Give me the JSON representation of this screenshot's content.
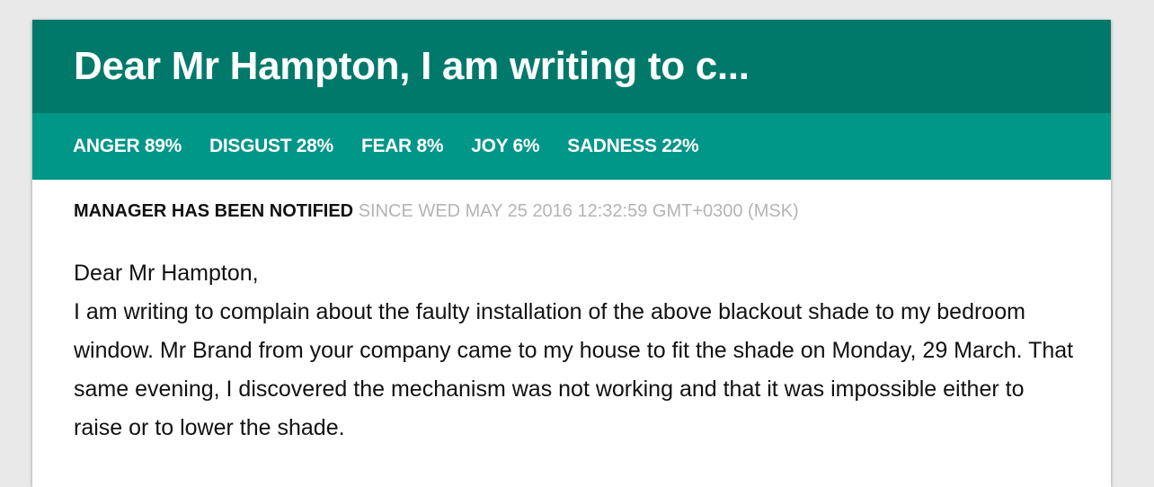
{
  "card": {
    "title": "Dear Mr Hampton, I am writing to c..."
  },
  "emotions": [
    {
      "label": "ANGER 89%"
    },
    {
      "label": "DISGUST 28%"
    },
    {
      "label": "FEAR 8%"
    },
    {
      "label": "JOY 6%"
    },
    {
      "label": "SADNESS 22%"
    }
  ],
  "status": {
    "label": "MANAGER HAS BEEN NOTIFIED",
    "since": "SINCE WED MAY 25 2016 12:32:59 GMT+0300 (MSK)"
  },
  "letter": {
    "greeting": "Dear Mr Hampton,",
    "body": "I am writing to complain about the faulty installation of the above blackout shade to my bedroom window. Mr Brand from your company came to my house to fit the shade on Monday, 29 March. That same evening, I discovered the mechanism was not working and that it was impossible either to raise or to lower the shade."
  },
  "colors": {
    "header": "#00796b",
    "emotion_bar": "#009688",
    "background": "#e9e9e9",
    "since_text": "#b4b4b4"
  }
}
